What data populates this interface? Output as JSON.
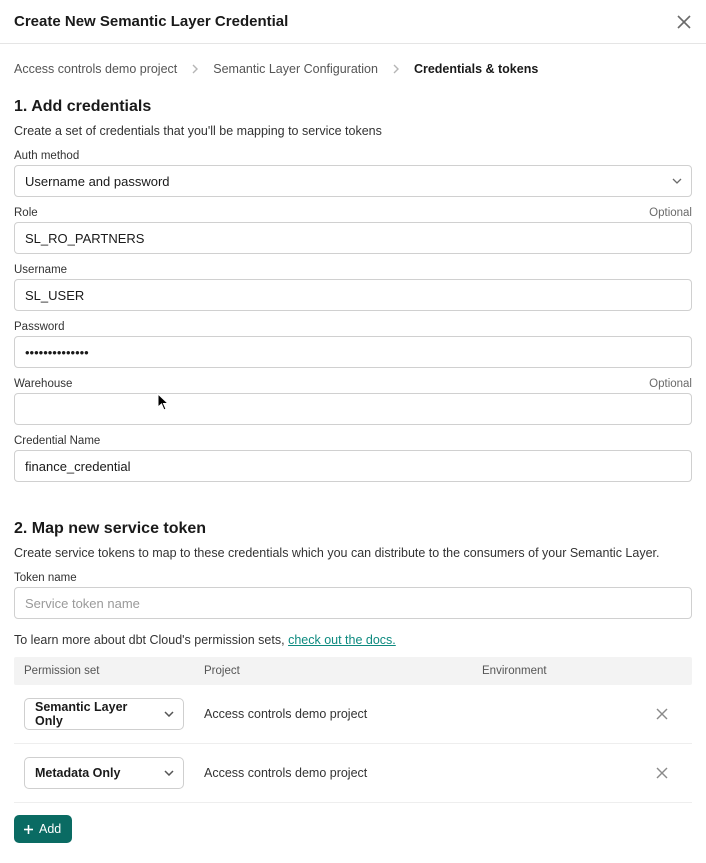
{
  "modal_title": "Create New Semantic Layer Credential",
  "breadcrumb": [
    "Access controls demo project",
    "Semantic Layer Configuration",
    "Credentials & tokens"
  ],
  "section1": {
    "title": "1. Add credentials",
    "description": "Create a set of credentials that you'll be mapping to service tokens",
    "fields": {
      "auth_method": {
        "label": "Auth method",
        "value": "Username and password"
      },
      "role": {
        "label": "Role",
        "optional": "Optional",
        "value": "SL_RO_PARTNERS"
      },
      "username": {
        "label": "Username",
        "value": "SL_USER"
      },
      "password": {
        "label": "Password",
        "value": "••••••••••••••"
      },
      "warehouse": {
        "label": "Warehouse",
        "optional": "Optional",
        "value": ""
      },
      "credential_name": {
        "label": "Credential Name",
        "value": "finance_credential"
      }
    }
  },
  "section2": {
    "title": "2. Map new service token",
    "description": "Create service tokens to map to these credentials which you can distribute to the consumers of your Semantic Layer.",
    "token_name": {
      "label": "Token name",
      "placeholder": "Service token name",
      "value": ""
    },
    "docs_text": "To learn more about dbt Cloud's permission sets, ",
    "docs_link": "check out the docs.",
    "table": {
      "headers": {
        "permission_set": "Permission set",
        "project": "Project",
        "environment": "Environment"
      },
      "rows": [
        {
          "permission_set": "Semantic Layer Only",
          "project": "Access controls demo project"
        },
        {
          "permission_set": "Metadata Only",
          "project": "Access controls demo project"
        }
      ]
    },
    "add_button": "Add"
  }
}
